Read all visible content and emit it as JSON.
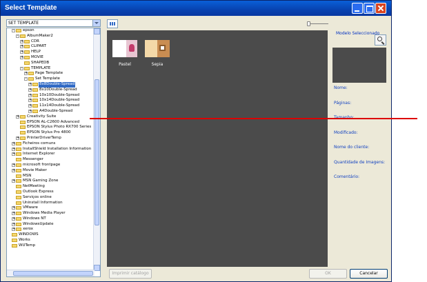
{
  "window": {
    "title": "Select Template"
  },
  "dropdown": {
    "value": "SET TEMPLATE"
  },
  "tree": {
    "items": [
      {
        "label": "epson",
        "depth": 0,
        "expander": "-"
      },
      {
        "label": "AlbumMaker2",
        "depth": 1,
        "expander": "-"
      },
      {
        "label": "CDR",
        "depth": 2,
        "expander": "+"
      },
      {
        "label": "CLIPART",
        "depth": 2,
        "expander": "+"
      },
      {
        "label": "HELP",
        "depth": 2,
        "expander": "+"
      },
      {
        "label": "MOVIE",
        "depth": 2,
        "expander": "+"
      },
      {
        "label": "SHAPEDB",
        "depth": 2,
        "expander": ""
      },
      {
        "label": "TEMPLATE",
        "depth": 2,
        "expander": "-"
      },
      {
        "label": "Page Template",
        "depth": 3,
        "expander": "+"
      },
      {
        "label": "Set Template",
        "depth": 3,
        "expander": "-"
      },
      {
        "label": "8x8Double-Spread",
        "depth": 4,
        "expander": "+",
        "selected": true
      },
      {
        "label": "8x10Double-Spread",
        "depth": 4,
        "expander": "+"
      },
      {
        "label": "10x10Double-Spread",
        "depth": 4,
        "expander": "+"
      },
      {
        "label": "10x14Double-Spread",
        "depth": 4,
        "expander": "+"
      },
      {
        "label": "11x14Double-Spread",
        "depth": 4,
        "expander": "+"
      },
      {
        "label": "A4Double-Spread",
        "depth": 4,
        "expander": "+"
      },
      {
        "label": "Creativity Suite",
        "depth": 1,
        "expander": "+"
      },
      {
        "label": "EPSON AL-C2600 Advanced",
        "depth": 1,
        "expander": ""
      },
      {
        "label": "EPSON Stylus Photo RX700 Series",
        "depth": 1,
        "expander": ""
      },
      {
        "label": "EPSON Stylus Pro 4800",
        "depth": 1,
        "expander": ""
      },
      {
        "label": "PrinterDriverTemp",
        "depth": 1,
        "expander": "+"
      },
      {
        "label": "Ficheiros comuns",
        "depth": 0,
        "expander": "+"
      },
      {
        "label": "InstallShield Installation Information",
        "depth": 0,
        "expander": "+"
      },
      {
        "label": "Internet Explorer",
        "depth": 0,
        "expander": "+"
      },
      {
        "label": "Messenger",
        "depth": 0,
        "expander": ""
      },
      {
        "label": "microsoft frontpage",
        "depth": 0,
        "expander": "+"
      },
      {
        "label": "Movie Maker",
        "depth": 0,
        "expander": "+"
      },
      {
        "label": "MSN",
        "depth": 0,
        "expander": ""
      },
      {
        "label": "MSN Gaming Zone",
        "depth": 0,
        "expander": "+"
      },
      {
        "label": "NetMeeting",
        "depth": 0,
        "expander": ""
      },
      {
        "label": "Outlook Express",
        "depth": 0,
        "expander": ""
      },
      {
        "label": "Serviços online",
        "depth": 0,
        "expander": ""
      },
      {
        "label": "Uninstall Information",
        "depth": 0,
        "expander": ""
      },
      {
        "label": "VMware",
        "depth": 0,
        "expander": "+"
      },
      {
        "label": "Windows Media Player",
        "depth": 0,
        "expander": "+"
      },
      {
        "label": "Windows NT",
        "depth": 0,
        "expander": "+"
      },
      {
        "label": "WindowsUpdate",
        "depth": 0,
        "expander": "+"
      },
      {
        "label": "xerox",
        "depth": 0,
        "expander": "+"
      },
      {
        "label": "WINDOWS",
        "depth": -1,
        "expander": ""
      },
      {
        "label": "Works",
        "depth": -1,
        "expander": ""
      },
      {
        "label": "WUTemp",
        "depth": -1,
        "expander": ""
      }
    ]
  },
  "templates": [
    {
      "name": "Pastel",
      "thumb_icon": "pastel-thumbnail"
    },
    {
      "name": "Sepia",
      "thumb_icon": "sepia-thumbnail"
    }
  ],
  "buttons": {
    "print": "Imprimir catálogo",
    "ok": "OK",
    "cancel": "Cancelar"
  },
  "info_panel": {
    "title": "Modelo Seleccionado",
    "labels": {
      "name": "Nome:",
      "pages": "Páginas:",
      "size": "Tamanho:",
      "modified": "Modificado:",
      "client": "Nome do cliente:",
      "image_count": "Quantidade de Imagens:",
      "comment": "Comentário:"
    }
  },
  "colors": {
    "selection": "#316ac5",
    "canvas": "#4b4b4b",
    "info_label": "#1040c0",
    "annotation_line": "#dd0000"
  }
}
